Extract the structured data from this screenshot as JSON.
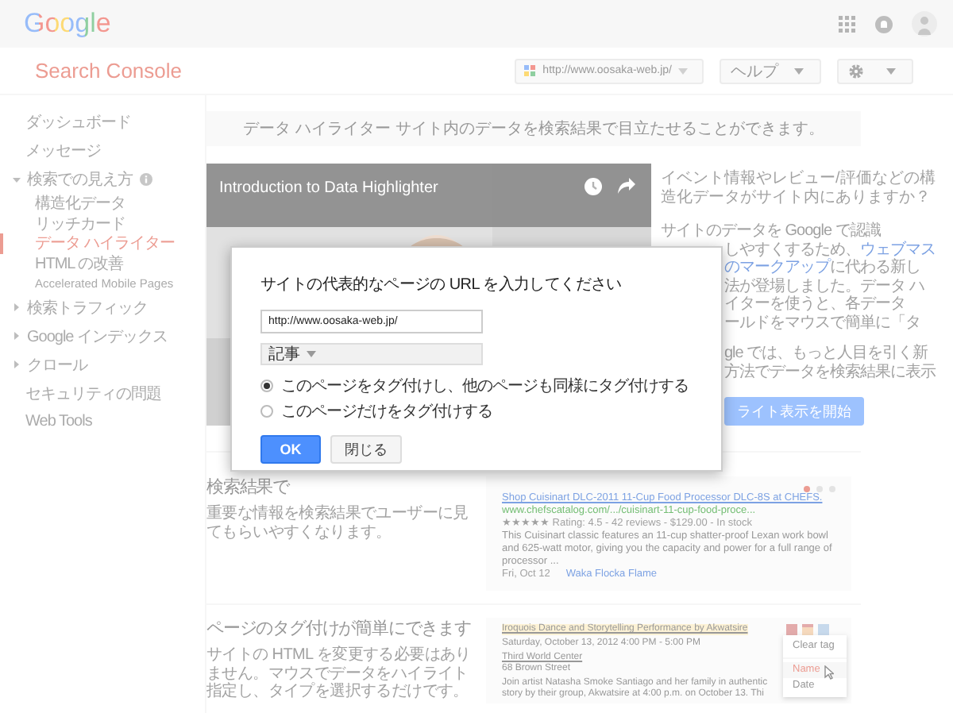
{
  "header": {
    "logo": "Google"
  },
  "app_bar": {
    "title": "Search Console",
    "site_selector": "http://www.oosaka-web.jp/",
    "help": "ヘルプ"
  },
  "sidebar": {
    "items": [
      {
        "label": "ダッシュボード",
        "selected": false
      },
      {
        "label": "メッセージ",
        "selected": false
      },
      {
        "label": "検索での見え方",
        "selected": false,
        "expanded": true,
        "info": true,
        "children": [
          {
            "label": "構造化データ",
            "selected": false
          },
          {
            "label": "リッチカード",
            "selected": false
          },
          {
            "label": "データ ハイライター",
            "selected": true
          },
          {
            "label": "HTML の改善",
            "selected": false
          },
          {
            "label": "Accelerated Mobile Pages",
            "selected": false
          }
        ]
      },
      {
        "label": "検索トラフィック",
        "selected": false,
        "expanded": false
      },
      {
        "label": "Google インデックス",
        "selected": false,
        "expanded": false
      },
      {
        "label": "クロール",
        "selected": false,
        "expanded": false
      },
      {
        "label": "セキュリティの問題",
        "selected": false
      },
      {
        "label": "Web Tools",
        "selected": false
      }
    ]
  },
  "banner": "データ ハイライター サイト内のデータを検索結果で目立たせることができます。",
  "video": {
    "kind": "picture",
    "title": "Introduction to Data Highlighter"
  },
  "intro": {
    "question": "イベント情報やレビュー/評価などの構造化データがサイト内にありますか？",
    "first_line": "サイトのデータを Google で認識",
    "lines_beside_dialog": [
      {
        "parts": [
          {
            "text": "しやすくするため、",
            "link": false
          },
          {
            "text": "ウェブマス",
            "link": true
          }
        ]
      },
      {
        "parts": [
          {
            "text": "のマークアップ",
            "link": true
          },
          {
            "text": "に代わる新し",
            "link": false
          }
        ]
      },
      {
        "parts": [
          {
            "text": "法が登場しました。データ ハ",
            "link": false
          }
        ]
      },
      {
        "parts": [
          {
            "text": "イターを使うと、各データ",
            "link": false
          }
        ]
      },
      {
        "parts": [
          {
            "text": "ールドをマウスで簡単に「タ",
            "link": false
          }
        ]
      },
      {
        "parts": [
          {
            "text": "gle では、もっと人目を引く新",
            "link": false
          }
        ]
      },
      {
        "parts": [
          {
            "text": "方法でデータを検索結果に表示",
            "link": false
          }
        ]
      }
    ],
    "button": "ライト表示を開始"
  },
  "sections": [
    {
      "heading": "検索結果で",
      "text": "重要な情報を検索結果でユーザーに見てもらいやすくなります。",
      "example": {
        "kind": "result",
        "dots": [
          {
            "selected": true
          },
          {
            "selected": false
          },
          {
            "selected": false
          }
        ],
        "title": "Shop Cuisinart DLC-2011 11-Cup Food Processor DLC-8S at CHEFS.",
        "url": "www.chefscatalog.com/.../cuisinart-11-cup-food-proce...",
        "rating": "★★★★★ Rating: 4.5 - 42 reviews - $129.00 - In stock",
        "snippet": "This Cuisinart classic features an 11-cup shatter-proof Lexan work bowl and 625-watt motor, giving you the capacity and power for a full range of processor ...",
        "date": "Fri, Oct 12",
        "performer": "Waka Flocka Flame"
      }
    },
    {
      "heading": "ページのタグ付けが簡単にできます",
      "text": "サイトの HTML を変更する必要はありません。マウスでデータをハイライト指定し、タイプを選択するだけです。",
      "example": {
        "kind": "event",
        "title": "Iroquois Dance and Storytelling Performance by Akwatsire",
        "date": "Saturday, October 13, 2012 4:00 PM - 5:00 PM",
        "venue": "Third World Center",
        "street": "68 Brown Street",
        "body": [
          "Join artist Natasha Smoke Santiago and her family in authentic",
          "story by their group, Akwatsire at 4:00 p.m. on October 13. Thi"
        ],
        "menu": [
          {
            "label": "Clear tag",
            "selected": false
          },
          {
            "label": "Name",
            "selected": true
          },
          {
            "label": "Date",
            "selected": false
          }
        ]
      }
    }
  ],
  "dialog": {
    "title": "サイトの代表的なページの URL を入力してください",
    "url": "http://www.oosaka-web.jp/",
    "type": "記事",
    "options": [
      {
        "label": "このページをタグ付けし、他のページも同様にタグ付けする",
        "selected": true
      },
      {
        "label": "このページだけをタグ付けする",
        "selected": false
      }
    ],
    "buttons": [
      {
        "label": "OK",
        "kind": "primary"
      },
      {
        "label": "閉じる",
        "kind": "secondary"
      }
    ]
  }
}
